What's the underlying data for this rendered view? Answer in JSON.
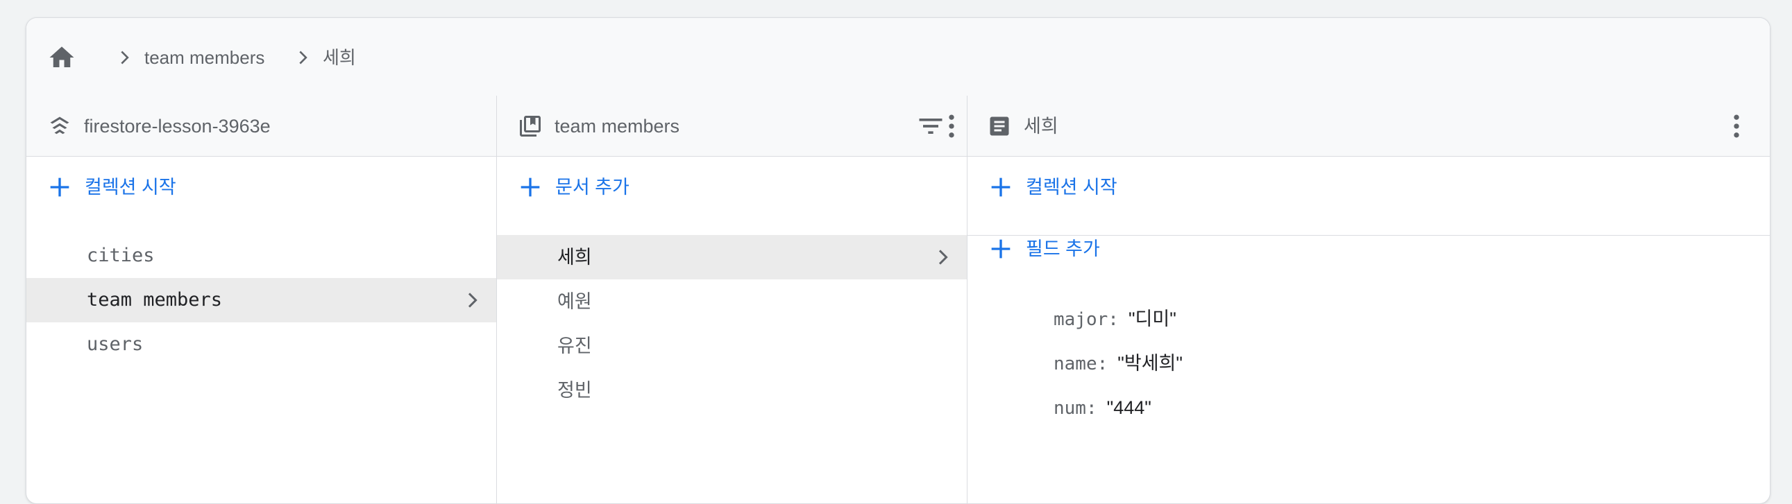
{
  "breadcrumb": {
    "home_icon": "home-icon",
    "items": [
      "team members",
      "세희"
    ]
  },
  "columns": {
    "root": {
      "title": "firestore-lesson-3963e",
      "icon": "firebase-layers-icon",
      "action_label": "컬렉션 시작",
      "items": [
        {
          "label": "cities",
          "selected": false
        },
        {
          "label": "team members",
          "selected": true
        },
        {
          "label": "users",
          "selected": false
        }
      ]
    },
    "collection": {
      "title": "team members",
      "icon": "collection-icon",
      "action_label": "문서 추가",
      "items": [
        {
          "label": "세희",
          "selected": true
        },
        {
          "label": "예원",
          "selected": false
        },
        {
          "label": "유진",
          "selected": false
        },
        {
          "label": "정빈",
          "selected": false
        }
      ]
    },
    "document": {
      "title": "세희",
      "icon": "document-icon",
      "start_collection_label": "컬렉션 시작",
      "add_field_label": "필드 추가",
      "fields": [
        {
          "key": "major",
          "value": "\"디미\""
        },
        {
          "key": "name",
          "value": "\"박세희\""
        },
        {
          "key": "num",
          "value": "\"444\""
        }
      ]
    }
  },
  "colors": {
    "accent": "#1a73e8",
    "header_bg": "#f8f9fa",
    "selected_bg": "#ebebeb",
    "border": "#dadce0"
  }
}
